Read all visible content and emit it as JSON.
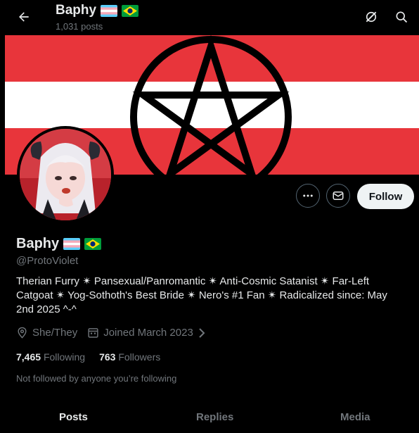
{
  "header": {
    "name": "Baphy",
    "post_count": "1,031 posts",
    "back_icon": "back-arrow-icon",
    "grok_icon": "grok-icon",
    "search_icon": "search-icon"
  },
  "profile": {
    "name": "Baphy",
    "handle": "@ProtoViolet",
    "bio": "Therian Furry ✴ Pansexual/Panromantic ✴ Anti-Cosmic Satanist ✴ Far-Left Catgoat ✴ Yog-Sothoth's Best Bride ✴ Nero's #1 Fan ✴ Radicalized since: May 2nd 2025 ^-^",
    "pronouns": "She/They",
    "joined": "Joined March 2023",
    "following_count": "7,465",
    "following_label": "Following",
    "followers_count": "763",
    "followers_label": "Followers",
    "not_followed_text": "Not followed by anyone you’re following"
  },
  "actions": {
    "follow_label": "Follow"
  },
  "tabs": [
    {
      "label": "Posts",
      "active": true
    },
    {
      "label": "Replies",
      "active": false
    },
    {
      "label": "Media",
      "active": false
    }
  ],
  "colors": {
    "banner_red": "#e8353b",
    "banner_white": "#ffffff",
    "trans_blue": "#5bcefa",
    "trans_pink": "#f5a9b8",
    "brazil_green": "#009c3b",
    "brazil_yellow": "#ffdf00",
    "brazil_blue": "#002776"
  }
}
